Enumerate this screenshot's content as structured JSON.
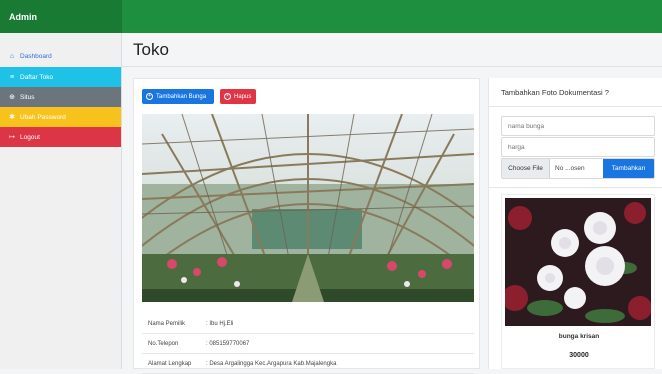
{
  "app": {
    "brand": "Admin"
  },
  "sidebar": {
    "items": [
      {
        "label": "Dashboard",
        "icon": "home-icon"
      },
      {
        "label": "Daftar Toko",
        "icon": "list-icon"
      },
      {
        "label": "Situs",
        "icon": "globe-icon"
      },
      {
        "label": "Ubah Password",
        "icon": "key-icon"
      },
      {
        "label": "Logout",
        "icon": "logout-icon"
      }
    ]
  },
  "page": {
    "title": "Toko"
  },
  "toolbar": {
    "add_label": "Tambahkan Bunga",
    "delete_label": "Hapus"
  },
  "store": {
    "rows": [
      {
        "key": "Nama Pemilik",
        "value": ": Ibu Hj.Eli"
      },
      {
        "key": "No.Telepon",
        "value": ": 085159770067"
      },
      {
        "key": "Alamat Lengkap",
        "value": ": Desa Argalingga Kec.Argapura Kab.Majalengka"
      }
    ]
  },
  "form": {
    "title": "Tambahkan Foto Dokumentasi ?",
    "name_placeholder": "nama bunga",
    "price_placeholder": "harga",
    "choose_file_label": "Choose File",
    "no_file_label": "No ...osen",
    "submit_label": "Tambahkan"
  },
  "product": {
    "name": "bunga krisan",
    "price": "30000"
  },
  "colors": {
    "topbar": "#1e8f3e",
    "info": "#1fc1e6",
    "secondary": "#6c757d",
    "warning": "#f7c21b",
    "danger": "#dc3545",
    "primary": "#1976e0"
  }
}
